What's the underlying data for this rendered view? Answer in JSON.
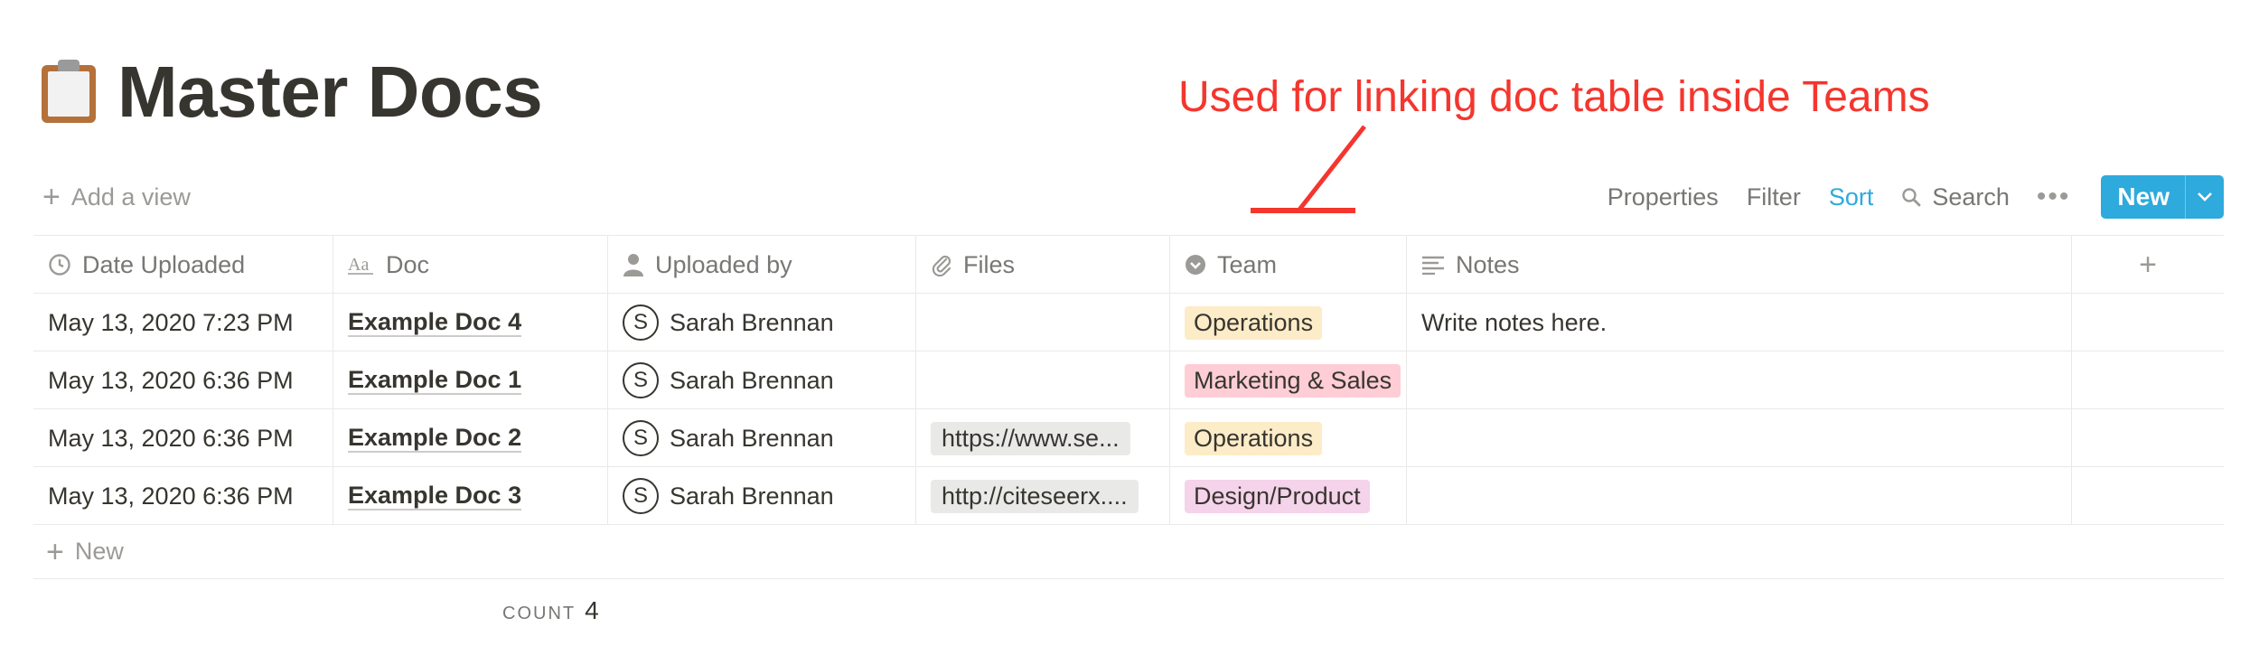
{
  "page": {
    "title": "Master Docs",
    "icon": "clipboard-icon"
  },
  "annotation": {
    "text": "Used for linking doc table inside Teams",
    "color": "#f4362e"
  },
  "toolbar": {
    "add_view": "Add a view",
    "properties": "Properties",
    "filter": "Filter",
    "sort": "Sort",
    "search": "Search",
    "new": "New",
    "accent": "#2eaadc"
  },
  "table": {
    "columns": [
      {
        "label": "Date Uploaded",
        "icon": "clock-icon"
      },
      {
        "label": "Doc",
        "icon": "title-text-icon"
      },
      {
        "label": "Uploaded by",
        "icon": "person-icon"
      },
      {
        "label": "Files",
        "icon": "paperclip-icon"
      },
      {
        "label": "Team",
        "icon": "select-icon"
      },
      {
        "label": "Notes",
        "icon": "text-lines-icon"
      }
    ],
    "rows": [
      {
        "date": "May 13, 2020 7:23 PM",
        "doc": "Example Doc 4",
        "initial": "S",
        "uploader": "Sarah Brennan",
        "file": "",
        "team": "Operations",
        "team_color": "#fdecc8",
        "notes": "Write notes here."
      },
      {
        "date": "May 13, 2020 6:36 PM",
        "doc": "Example Doc 1",
        "initial": "S",
        "uploader": "Sarah Brennan",
        "file": "",
        "team": "Marketing & Sales",
        "team_color": "#ffcdd6",
        "notes": ""
      },
      {
        "date": "May 13, 2020 6:36 PM",
        "doc": "Example Doc 2",
        "initial": "S",
        "uploader": "Sarah Brennan",
        "file": "https://www.se...",
        "team": "Operations",
        "team_color": "#fdecc8",
        "notes": ""
      },
      {
        "date": "May 13, 2020 6:36 PM",
        "doc": "Example Doc 3",
        "initial": "S",
        "uploader": "Sarah Brennan",
        "file": "http://citeseerx....",
        "team": "Design/Product",
        "team_color": "#f5d3ea",
        "notes": ""
      }
    ],
    "new_row": "New",
    "count_label": "COUNT",
    "count_value": "4"
  }
}
